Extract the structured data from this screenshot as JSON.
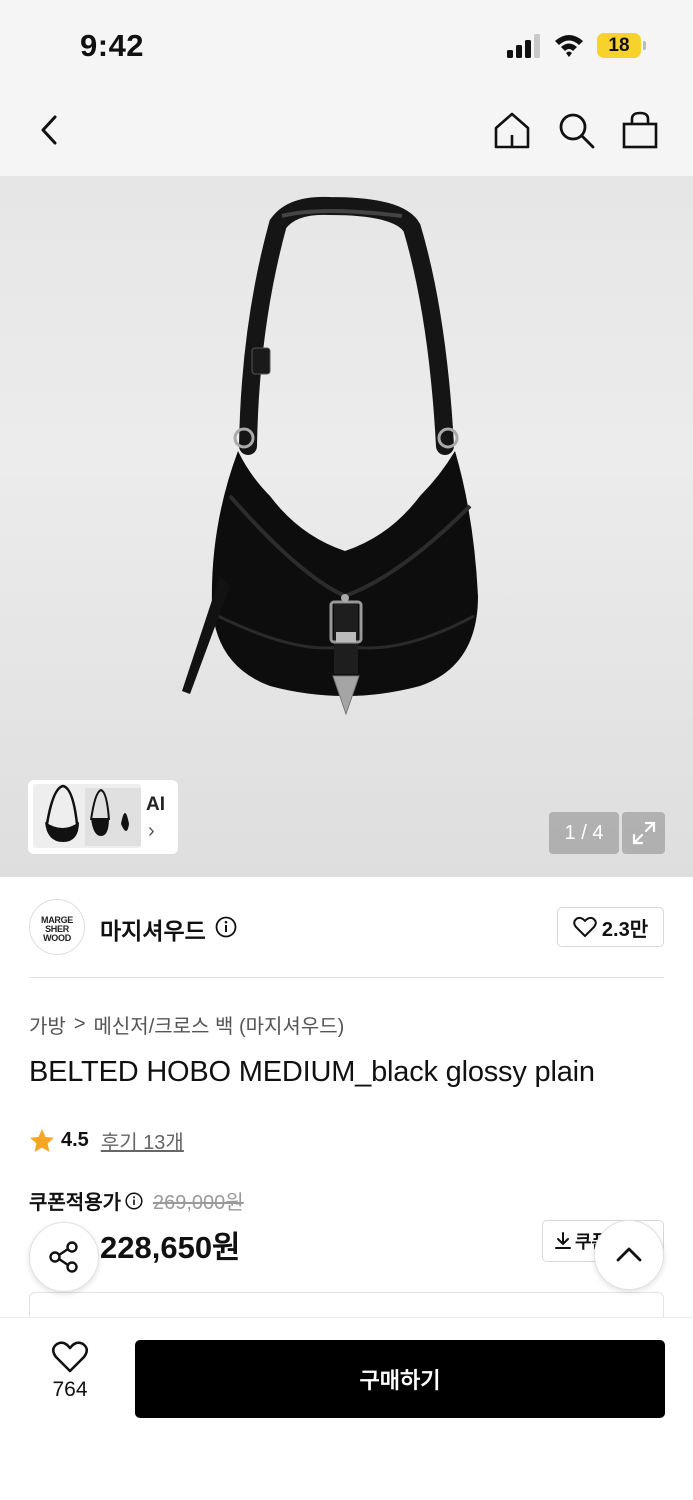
{
  "status_bar": {
    "time": "9:42",
    "battery": "18"
  },
  "nav": {
    "back_icon": "chevron-left-icon",
    "home_icon": "home-icon",
    "search_icon": "search-icon",
    "cart_icon": "shopping-bag-icon"
  },
  "gallery": {
    "thumb_label": "AI",
    "pager": "1 / 4"
  },
  "brand": {
    "logo_text": [
      "MARGE",
      "SHER",
      "WOOD"
    ],
    "name": "마지셔우드",
    "likes": "2.3만"
  },
  "breadcrumb": {
    "level1": "가방",
    "separator": ">",
    "level2": "메신저/크로스 백 (마지셔우드)"
  },
  "product": {
    "title": "BELTED HOBO MEDIUM_black glossy plain",
    "rating": "4.5",
    "reviews": "후기 13개"
  },
  "price": {
    "coupon_label": "쿠폰적용가",
    "original": "269,000원",
    "final": "228,650원",
    "coupon_button": "쿠폰"
  },
  "bottom_bar": {
    "wish_count": "764",
    "buy_label": "구매하기"
  },
  "colors": {
    "accent": "#000000",
    "star": "#f5a623",
    "discount": "#e52b2b",
    "battery": "#f6d22b"
  }
}
